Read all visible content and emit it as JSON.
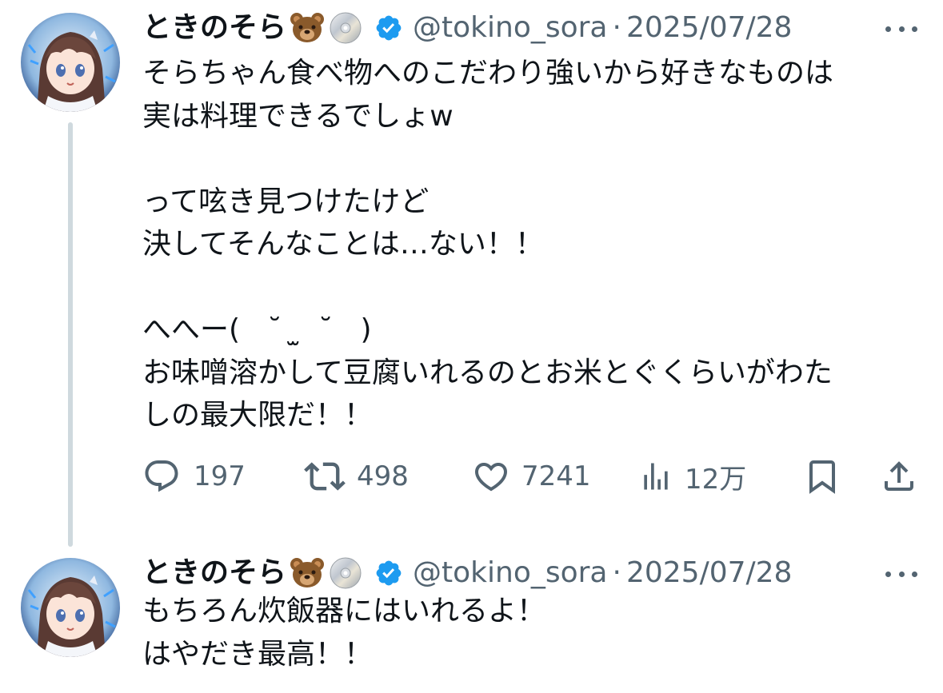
{
  "tweets": [
    {
      "author": {
        "display_name": "ときのそら",
        "name_emojis": [
          "bear-face-emoji",
          "optical-disc-emoji"
        ],
        "verified": true,
        "handle": "@tokino_sora"
      },
      "separator": "·",
      "date": "2025/07/28",
      "text": "そらちゃん食べ物へのこだわり強いから好きなものは\n実は料理できるでしょw\n\nって呟き見つけたけど\n決してそんなことは…ない！！\n\nへへー(   ˘  ̫  ˘   )\nお味噌溶かして豆腐いれるのとお米とぐくらいがわた\nしの最大限だ！！",
      "actions": {
        "reply_count": "197",
        "repost_count": "498",
        "like_count": "7241",
        "view_count": "12万"
      }
    },
    {
      "author": {
        "display_name": "ときのそら",
        "name_emojis": [
          "bear-face-emoji",
          "optical-disc-emoji"
        ],
        "verified": true,
        "handle": "@tokino_sora"
      },
      "separator": "·",
      "date": "2025/07/28",
      "text": "もちろん炊飯器にはいれるよ！\nはやだき最高！！"
    }
  ],
  "colors": {
    "text": "#0f1419",
    "secondary": "#536471",
    "verified": "#1d9bf0",
    "thread_line": "#cfd9de"
  }
}
